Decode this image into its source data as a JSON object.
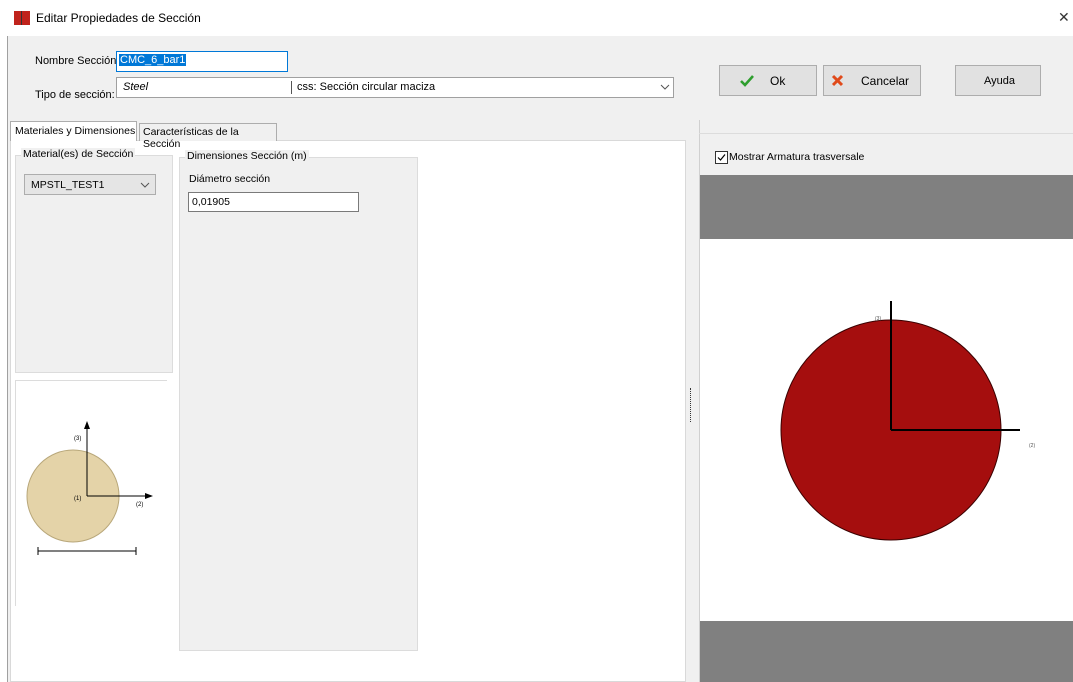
{
  "window": {
    "title": "Editar Propiedades de Sección",
    "close_glyph": "✕",
    "icon": "app-book-icon",
    "colors": {
      "icon_red": "#c0231c",
      "icon_dark": "#333333"
    }
  },
  "header": {
    "name_label": "Nombre Sección:",
    "name_value": "CMC_6_bar1",
    "type_label": "Tipo de sección:",
    "type_material_family": "Steel",
    "type_value": "css: Sección circular maciza"
  },
  "buttons": {
    "ok": "Ok",
    "cancel": "Cancelar",
    "help": "Ayuda",
    "colors": {
      "ok_check": "#2e9e2e",
      "cancel_x": "#e04a1a"
    }
  },
  "tabs": [
    {
      "label": "Materiales y Dimensiones",
      "active": true
    },
    {
      "label": "Características de la Sección",
      "active": false
    }
  ],
  "materials": {
    "group_title": "Material(es) de Sección",
    "selected": "MPSTL_TEST1"
  },
  "dimensions": {
    "group_title": "Dimensiones Sección (m)",
    "diameter_label": "Diámetro sección",
    "diameter_value": "0,01905"
  },
  "thumbnail": {
    "axis_labels": [
      "(3)",
      "(1)",
      "(2)"
    ],
    "fill_color": "#e4d3a8"
  },
  "preview": {
    "checkbox_label": "Mostrar Armatura trasversale",
    "checkbox_checked": true,
    "check_glyph": "✓",
    "axis_labels": [
      "(3)",
      "(2)"
    ],
    "fill_color": "#a50e0e",
    "band_color": "#808080"
  }
}
